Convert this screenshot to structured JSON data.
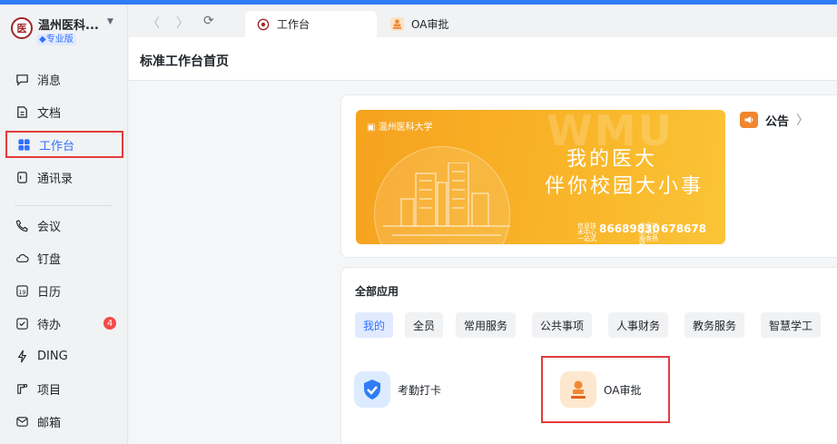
{
  "org": {
    "name": "温州医科...",
    "edition": "专业版",
    "logo_text": "医"
  },
  "sidebar": {
    "items": [
      {
        "label": "消息",
        "icon": "message-icon"
      },
      {
        "label": "文档",
        "icon": "document-icon"
      },
      {
        "label": "工作台",
        "icon": "workbench-icon",
        "active": true
      },
      {
        "label": "通讯录",
        "icon": "contacts-icon"
      },
      {
        "label": "会议",
        "icon": "phone-icon"
      },
      {
        "label": "钉盘",
        "icon": "cloud-icon"
      },
      {
        "label": "日历",
        "icon": "calendar-icon",
        "calendar_day": "19"
      },
      {
        "label": "待办",
        "icon": "todo-icon",
        "badge": "4"
      },
      {
        "label": "DING",
        "icon": "ding-icon"
      },
      {
        "label": "项目",
        "icon": "project-icon"
      },
      {
        "label": "邮箱",
        "icon": "mail-icon"
      }
    ]
  },
  "tabs": [
    {
      "label": "工作台",
      "active": true
    },
    {
      "label": "OA审批",
      "active": false
    }
  ],
  "header": {
    "title": "标准工作台首页"
  },
  "banner": {
    "logo_text": "温州医科大学",
    "watermark": "WMU",
    "slogan_line1": "我的医大",
    "slogan_line2": "伴你校园大小事",
    "phone1_label": "信息技术中心一站式",
    "phone1": "86689830",
    "phone2_label": "信息技术中心服务热线",
    "phone2": "678678"
  },
  "notice": {
    "label": "公告"
  },
  "apps": {
    "title": "全部应用",
    "categories": [
      "我的",
      "全员",
      "常用服务",
      "公共事项",
      "人事财务",
      "教务服务",
      "智慧学工"
    ],
    "items": [
      {
        "label": "考勤打卡",
        "icon": "attendance-check-icon"
      },
      {
        "label": "OA审批",
        "icon": "oa-approval-stamp-icon"
      }
    ]
  },
  "colors": {
    "accent": "#3370ff",
    "highlight": "#e33b3b",
    "banner": "#f6a21e"
  }
}
